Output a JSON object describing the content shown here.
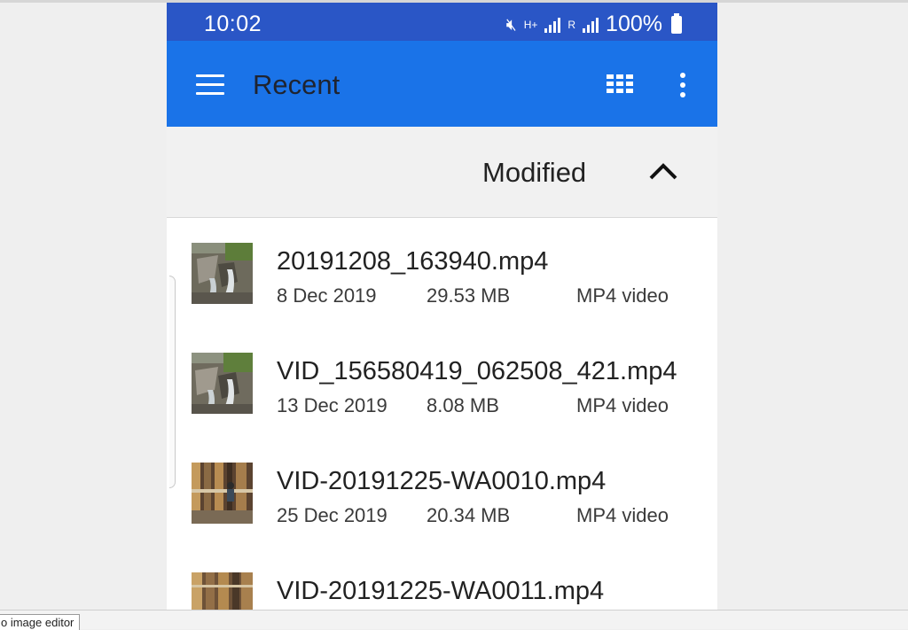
{
  "status_bar": {
    "time": "10:02",
    "network_label": "H+",
    "sim2_label": "R",
    "battery": "100%"
  },
  "app_bar": {
    "title": "Recent",
    "icons": [
      "menu-icon",
      "grid-view-icon",
      "more-options-icon"
    ]
  },
  "sort": {
    "label": "Modified",
    "direction_icon": "chevron-up-icon"
  },
  "files": [
    {
      "name": "20191208_163940.mp4",
      "date": "8 Dec 2019",
      "size": "29.53 MB",
      "type": "MP4 video"
    },
    {
      "name": "VID_156580419_062508_421.mp4",
      "date": "13 Dec 2019",
      "size": "8.08 MB",
      "type": "MP4 video"
    },
    {
      "name": "VID-20191225-WA0010.mp4",
      "date": "25 Dec 2019",
      "size": "20.34 MB",
      "type": "MP4 video"
    },
    {
      "name": "VID-20191225-WA0011.mp4",
      "date": "",
      "size": "",
      "type": ""
    }
  ],
  "taskbar": {
    "tab_label": "o image editor"
  },
  "colors": {
    "status_bar": "#2a56c6",
    "app_bar": "#1a73e8",
    "list_background": "#ffffff",
    "page_background": "#efefef"
  }
}
